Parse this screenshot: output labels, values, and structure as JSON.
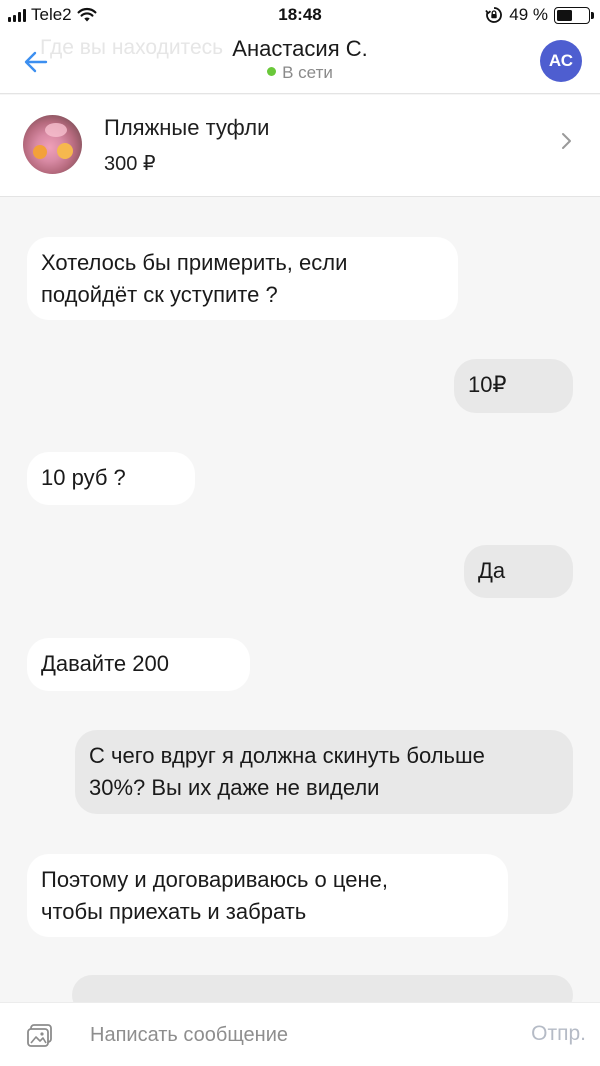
{
  "status_bar": {
    "carrier": "Tele2",
    "time": "18:48",
    "battery_percent": "49 %",
    "battery_level": 0.49
  },
  "header": {
    "background_text": "Где вы находитесь",
    "contact_name": "Анастасия С.",
    "presence": "В сети",
    "avatar_initials": "АС",
    "avatar_color": "#4e5ed0",
    "online_color": "#6ac83a"
  },
  "item": {
    "title": "Пляжные туфли",
    "price": "300 ₽"
  },
  "messages": [
    {
      "direction": "in",
      "lines": [
        "Хотелось бы примерить, если",
        "подойдёт ск уступите ?"
      ]
    },
    {
      "direction": "out",
      "lines": [
        "10₽"
      ]
    },
    {
      "direction": "in",
      "lines": [
        "10 руб ?"
      ]
    },
    {
      "direction": "out",
      "lines": [
        "Да"
      ]
    },
    {
      "direction": "in",
      "lines": [
        "Давайте 200"
      ]
    },
    {
      "direction": "out",
      "lines": [
        "С чего вдруг я должна скинуть больше",
        "30%? Вы их даже не видели"
      ]
    },
    {
      "direction": "in",
      "lines": [
        "Поэтому и договариваюсь о цене,",
        "чтобы приехать и забрать"
      ]
    }
  ],
  "composer": {
    "placeholder": "Написать сообщение",
    "send_label": "Отпр."
  },
  "icons": {
    "back": "arrow-left-icon",
    "chevron": "chevron-right-icon",
    "attach": "image-attach-icon",
    "wifi": "wifi-icon",
    "lock": "orientation-lock-icon"
  }
}
